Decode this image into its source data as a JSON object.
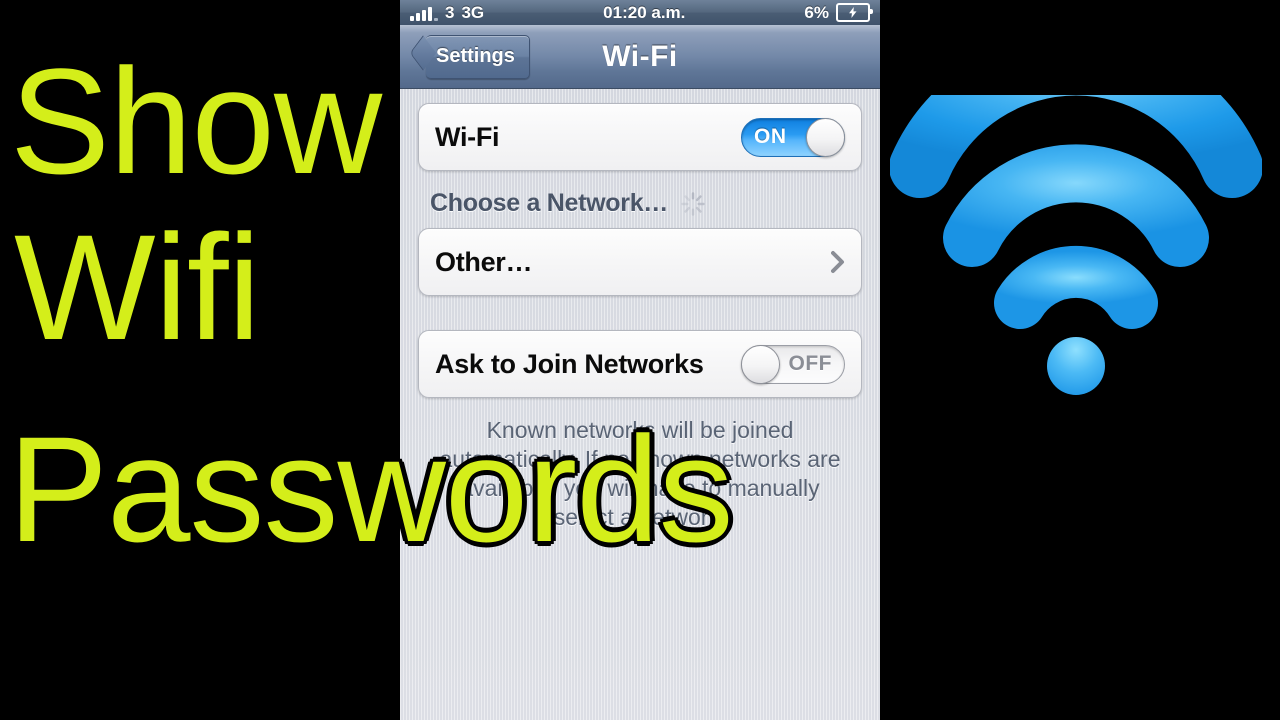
{
  "thumbnail": {
    "title_lines": [
      "Show",
      "Wifi",
      "Passwords"
    ],
    "title_color": "#d4ee1a",
    "outline_color": "#000000",
    "background_color": "#000000",
    "logo": {
      "name": "wifi-logo",
      "color": "#1b9ae8",
      "highlight_color": "#5fc8f5",
      "arc_count": 3,
      "has_dot": true
    }
  },
  "phone": {
    "status_bar": {
      "signal_bars_filled": 4,
      "signal_bars_total": 5,
      "carrier": "3",
      "network_type": "3G",
      "time": "01:20 a.m.",
      "battery_percent": "6%",
      "battery_charging": true
    },
    "nav_bar": {
      "back_label": "Settings",
      "title": "Wi-Fi"
    },
    "sections": {
      "wifi_row": {
        "label": "Wi-Fi",
        "toggle_state": "ON",
        "toggle_on": true
      },
      "choose_network": {
        "header": "Choose a Network…",
        "loading": true,
        "rows": [
          {
            "label": "Other…",
            "has_chevron": true
          }
        ]
      },
      "ask_to_join": {
        "label": "Ask to Join Networks",
        "toggle_state": "OFF",
        "toggle_on": false,
        "footer": "Known networks will be joined automatically. If no known networks are available, you will have to manually select a network."
      }
    }
  }
}
